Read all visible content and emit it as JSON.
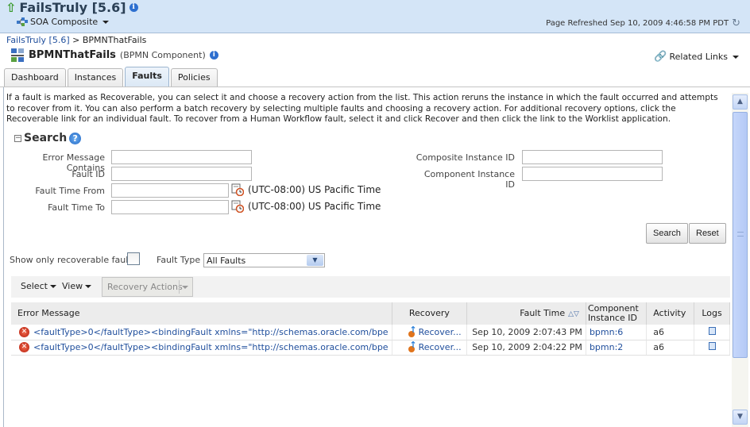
{
  "header": {
    "title": "FailsTruly [5.6]",
    "menu_label": "SOA Composite",
    "page_refreshed": "Page Refreshed Sep 10, 2009 4:46:58 PM PDT"
  },
  "breadcrumb": {
    "link": "FailsTruly [5.6]",
    "separator": ">",
    "current": "BPMNThatFails"
  },
  "component": {
    "name": "BPMNThatFails",
    "type": "(BPMN Component)",
    "related_links": "Related Links"
  },
  "tabs": [
    {
      "label": "Dashboard",
      "active": false
    },
    {
      "label": "Instances",
      "active": false
    },
    {
      "label": "Faults",
      "active": true
    },
    {
      "label": "Policies",
      "active": false
    }
  ],
  "description": "If a fault is marked as Recoverable, you can select it and choose a recovery action from the list. This action reruns the instance in which the fault occurred and attempts to recover from it. You can also perform a batch recovery by selecting multiple faults and choosing a recovery action. For additional recovery options, click the Recoverable link for an individual fault. To recover from a Human Workflow fault, select it and click Recover and then click the link to the Worklist application.",
  "search": {
    "heading": "Search",
    "collapse_symbol": "−",
    "fields": {
      "error_message_contains": {
        "label": "Error Message Contains",
        "value": ""
      },
      "fault_id": {
        "label": "Fault ID",
        "value": ""
      },
      "fault_time_from": {
        "label": "Fault Time From",
        "value": ""
      },
      "fault_time_to": {
        "label": "Fault Time To",
        "value": ""
      },
      "composite_instance_id": {
        "label": "Composite Instance ID",
        "value": ""
      },
      "component_instance_id": {
        "label": "Component Instance ID",
        "value": ""
      }
    },
    "timezone": "(UTC-08:00) US Pacific Time",
    "search_button": "Search",
    "reset_button": "Reset"
  },
  "filters": {
    "recoverable_label": "Show only recoverable faults",
    "recoverable_checked": false,
    "fault_type_label": "Fault Type",
    "fault_type_value": "All Faults"
  },
  "toolbar": {
    "select": "Select",
    "view": "View",
    "recovery_actions": "Recovery Actions"
  },
  "table": {
    "columns": [
      "Error Message",
      "Recovery",
      "Fault Time",
      "Component Instance ID",
      "Activity",
      "Logs"
    ],
    "rows": [
      {
        "error_message": "<faultType>0</faultType><bindingFault xmlns=\"http://schemas.oracle.com/bpe",
        "recovery": "Recover...",
        "fault_time": "Sep 10, 2009 2:07:43 PM",
        "component_instance_id": "bpmn:6",
        "activity": "a6"
      },
      {
        "error_message": "<faultType>0</faultType><bindingFault xmlns=\"http://schemas.oracle.com/bpe",
        "recovery": "Recover...",
        "fault_time": "Sep 10, 2009 2:04:22 PM",
        "component_instance_id": "bpmn:2",
        "activity": "a6"
      }
    ]
  },
  "colors": {
    "header_bg": "#d4e5f7",
    "link": "#1f4e9c",
    "error": "#c8260f"
  }
}
